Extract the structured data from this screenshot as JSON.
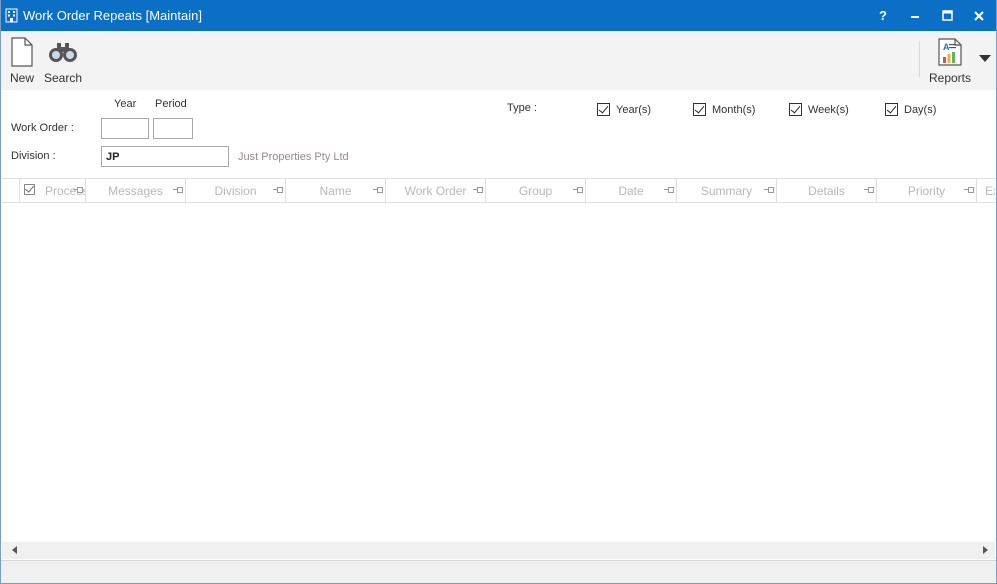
{
  "window": {
    "title": "Work Order Repeats [Maintain]",
    "help_label": "?",
    "accent": "#0c6fc6"
  },
  "toolbar": {
    "new_label": "New",
    "search_label": "Search",
    "reports_label": "Reports"
  },
  "filters": {
    "year_header": "Year",
    "period_header": "Period",
    "work_order_label": "Work Order :",
    "work_order_year": "",
    "work_order_period": "",
    "division_label": "Division :",
    "division_value": "JP",
    "division_description": "Just Properties Pty Ltd",
    "type_label": "Type :",
    "types": [
      {
        "label": "Year(s)",
        "checked": true
      },
      {
        "label": "Month(s)",
        "checked": true
      },
      {
        "label": "Week(s)",
        "checked": true
      },
      {
        "label": "Day(s)",
        "checked": true
      }
    ]
  },
  "grid": {
    "columns": [
      "Process",
      "Messages",
      "Division",
      "Name",
      "Work Order",
      "Group",
      "Date",
      "Summary",
      "Details",
      "Priority",
      "Ex"
    ],
    "rows": []
  }
}
